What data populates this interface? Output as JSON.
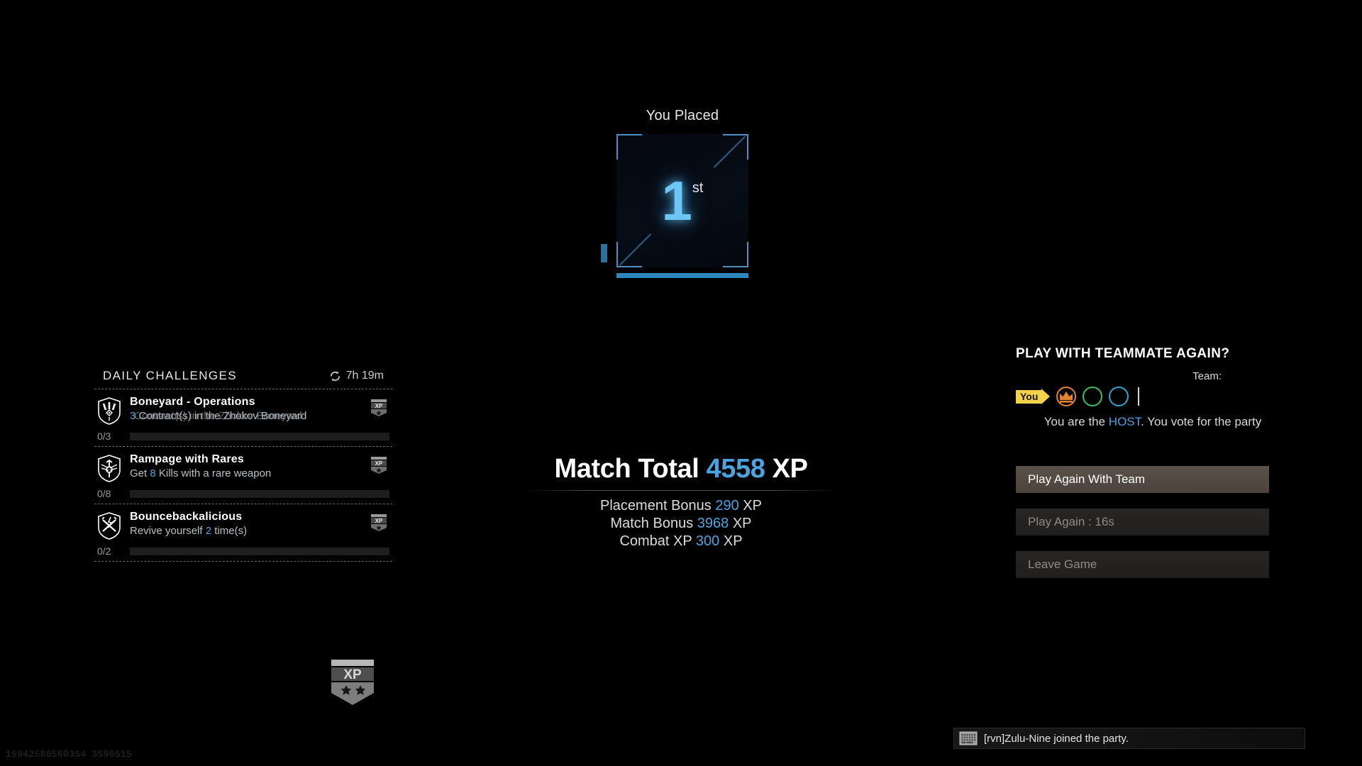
{
  "placement": {
    "label": "You Placed",
    "rank": "1",
    "suffix": "st",
    "accent": "#2d87bd"
  },
  "challenges": {
    "title": "DAILY CHALLENGES",
    "refresh_icon": "refresh-icon",
    "timer": "7h 19m",
    "items": [
      {
        "name": "Boneyard - Operations",
        "desc_prefix": "3",
        "desc": " Contract(s) in the Zhokov Boneyard",
        "desc_ghost": "Contract(s) in the Zhokov Boneyard",
        "progress_label": "0/3",
        "progress_pct": 0,
        "shield_icon": "operations-shield-icon",
        "xp_icon": "xp-badge-icon"
      },
      {
        "name": "Rampage with Rares",
        "desc_prefix": "Get ",
        "desc_value": "8",
        "desc": " Kills with a rare weapon",
        "progress_label": "0/8",
        "progress_pct": 0,
        "shield_icon": "rampage-shield-icon",
        "xp_icon": "xp-badge-icon"
      },
      {
        "name": "Bouncebackalicious",
        "desc_prefix": "Revive yourself ",
        "desc_value": "2",
        "desc": " time(s)",
        "progress_label": "0/2",
        "progress_pct": 0,
        "shield_icon": "revive-shield-icon",
        "xp_icon": "xp-badge-icon"
      }
    ]
  },
  "rank_emblem": "xp-rank-emblem-icon",
  "match": {
    "total_prefix": "Match Total ",
    "total_value": "4558",
    "total_suffix": " XP",
    "lines": [
      {
        "label": "Placement Bonus ",
        "value": "290",
        "unit": " XP"
      },
      {
        "label": "Match Bonus ",
        "value": "3968",
        "unit": " XP"
      },
      {
        "label": "Combat XP ",
        "value": "300",
        "unit": " XP"
      }
    ]
  },
  "team": {
    "title": "PLAY WITH TEAMMATE AGAIN?",
    "team_label": "Team:",
    "you_tag": "You",
    "note_prefix": "You are the ",
    "note_host": "HOST",
    "note_suffix": ". You vote for the party",
    "slots": [
      {
        "name": "host-slot",
        "icon": "crown-icon",
        "color": "#e0832c"
      },
      {
        "name": "teammate-slot-2",
        "icon": "empty-circle-icon",
        "color": "#3fbf5e"
      },
      {
        "name": "teammate-slot-3",
        "icon": "empty-circle-icon",
        "color": "#2ea4d4"
      }
    ]
  },
  "buttons": [
    {
      "label": "Play Again With Team",
      "state": "primary"
    },
    {
      "label": "Play Again : 16s",
      "state": "dim"
    },
    {
      "label": "Leave Game",
      "state": "dim"
    }
  ],
  "chat": {
    "icon": "keyboard-icon",
    "message": "[rvn]Zulu-Nine joined the party."
  },
  "watermark": "15942588560354 3596515"
}
